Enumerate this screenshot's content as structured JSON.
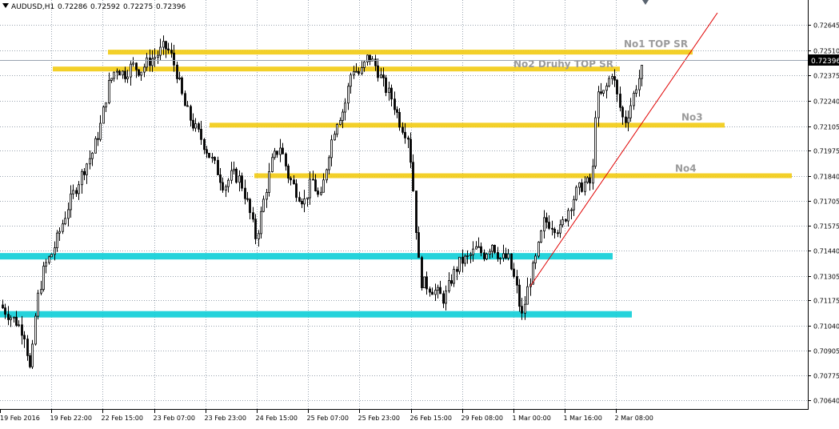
{
  "window": {
    "symbol_header": "AUDUSD,H1",
    "ohlc": [
      "0.72286",
      "0.72592",
      "0.72275",
      "0.72396"
    ],
    "current_price": "0.72396"
  },
  "chart_data": {
    "type": "candlestick",
    "symbol": "AUDUSD",
    "timeframe": "H1",
    "ylim": [
      0.7062,
      0.7271
    ],
    "grid": true,
    "price_ticks": [
      "0.72645",
      "0.72510",
      "0.72375",
      "0.72240",
      "0.72105",
      "0.71975",
      "0.71840",
      "0.71705",
      "0.71575",
      "0.71440",
      "0.71305",
      "0.71175",
      "0.71040",
      "0.70905",
      "0.70775",
      "0.70640"
    ],
    "time_ticks": [
      "19 Feb 2016",
      "19 Feb 22:00",
      "22 Feb 15:00",
      "23 Feb 07:00",
      "23 Feb 23:00",
      "24 Feb 15:00",
      "25 Feb 07:00",
      "25 Feb 23:00",
      "26 Feb 15:00",
      "29 Feb 08:00",
      "1 Mar 00:00",
      "1 Mar 16:00",
      "2 Mar 08:00"
    ],
    "price_path": [
      [
        0,
        0.7115
      ],
      [
        10,
        0.711
      ],
      [
        20,
        0.7106
      ],
      [
        30,
        0.71
      ],
      [
        38,
        0.7078
      ],
      [
        45,
        0.7115
      ],
      [
        55,
        0.7135
      ],
      [
        65,
        0.7143
      ],
      [
        75,
        0.7155
      ],
      [
        85,
        0.7168
      ],
      [
        95,
        0.7178
      ],
      [
        105,
        0.7188
      ],
      [
        115,
        0.7196
      ],
      [
        125,
        0.721
      ],
      [
        135,
        0.7232
      ],
      [
        145,
        0.7242
      ],
      [
        155,
        0.7238
      ],
      [
        165,
        0.7243
      ],
      [
        175,
        0.724
      ],
      [
        185,
        0.7245
      ],
      [
        195,
        0.7248
      ],
      [
        205,
        0.7253
      ],
      [
        212,
        0.725
      ],
      [
        220,
        0.724
      ],
      [
        230,
        0.7222
      ],
      [
        240,
        0.7212
      ],
      [
        250,
        0.7205
      ],
      [
        260,
        0.7196
      ],
      [
        270,
        0.7188
      ],
      [
        280,
        0.7178
      ],
      [
        290,
        0.7185
      ],
      [
        300,
        0.7182
      ],
      [
        310,
        0.7168
      ],
      [
        320,
        0.715
      ],
      [
        330,
        0.7172
      ],
      [
        340,
        0.7192
      ],
      [
        350,
        0.72
      ],
      [
        360,
        0.7184
      ],
      [
        370,
        0.7176
      ],
      [
        380,
        0.717
      ],
      [
        390,
        0.7182
      ],
      [
        400,
        0.717
      ],
      [
        410,
        0.7195
      ],
      [
        420,
        0.7213
      ],
      [
        430,
        0.722
      ],
      [
        440,
        0.7242
      ],
      [
        450,
        0.7238
      ],
      [
        460,
        0.7248
      ],
      [
        470,
        0.7242
      ],
      [
        480,
        0.7232
      ],
      [
        490,
        0.7225
      ],
      [
        500,
        0.7212
      ],
      [
        510,
        0.7205
      ],
      [
        515,
        0.7185
      ],
      [
        520,
        0.7155
      ],
      [
        525,
        0.7128
      ],
      [
        535,
        0.7125
      ],
      [
        545,
        0.7122
      ],
      [
        555,
        0.7118
      ],
      [
        565,
        0.713
      ],
      [
        575,
        0.7138
      ],
      [
        585,
        0.714
      ],
      [
        595,
        0.7145
      ],
      [
        605,
        0.7142
      ],
      [
        615,
        0.7148
      ],
      [
        625,
        0.714
      ],
      [
        635,
        0.714
      ],
      [
        645,
        0.7125
      ],
      [
        652,
        0.7108
      ],
      [
        660,
        0.7125
      ],
      [
        670,
        0.714
      ],
      [
        680,
        0.716
      ],
      [
        690,
        0.7158
      ],
      [
        700,
        0.7155
      ],
      [
        710,
        0.7166
      ],
      [
        720,
        0.7175
      ],
      [
        730,
        0.718
      ],
      [
        740,
        0.718
      ],
      [
        745,
        0.7225
      ],
      [
        755,
        0.7228
      ],
      [
        765,
        0.724
      ],
      [
        772,
        0.7225
      ],
      [
        780,
        0.7212
      ],
      [
        787,
        0.722
      ],
      [
        795,
        0.7232
      ],
      [
        802,
        0.724
      ]
    ],
    "levels": [
      {
        "label": "No1 TOP SR",
        "price": 0.725,
        "color": "#f2cc17"
      },
      {
        "label": "No2 Druhy TOP SR",
        "price": 0.7241,
        "color": "#f2cc17"
      },
      {
        "label": "No3",
        "price": 0.7211,
        "color": "#f2cc17"
      },
      {
        "label": "No4",
        "price": 0.7184,
        "color": "#f2cc17"
      },
      {
        "label": "",
        "price": 0.7141,
        "color": "#12cfd8"
      },
      {
        "label": "",
        "price": 0.711,
        "color": "#12cfd8"
      }
    ],
    "trendline_color": "#e00000"
  }
}
